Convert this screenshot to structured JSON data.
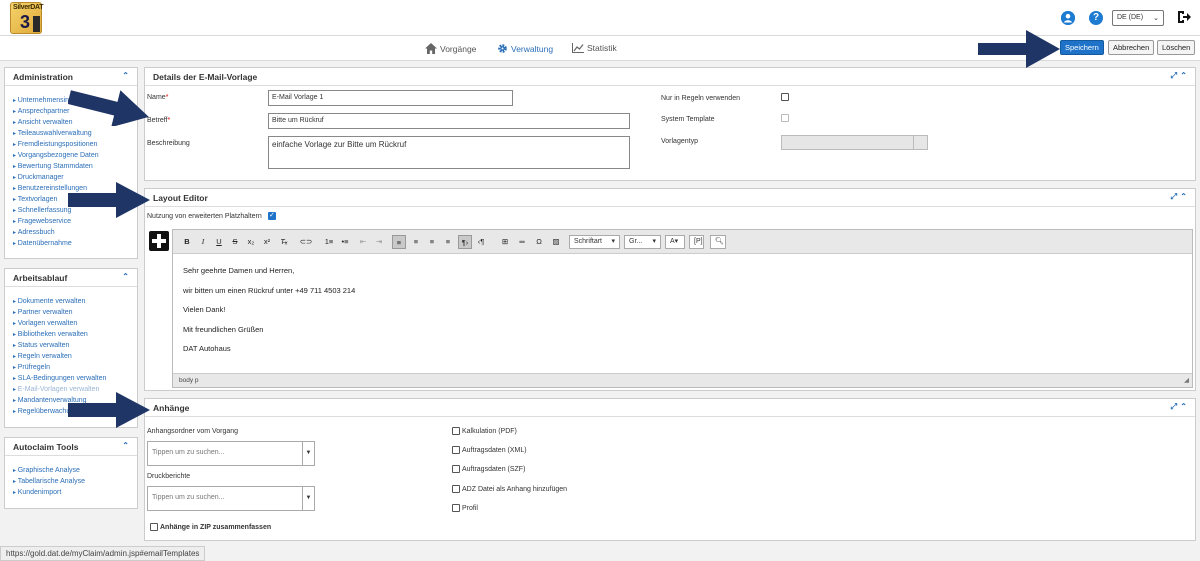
{
  "app": {
    "logo_text": "SilverDAT",
    "logo_number": "3",
    "language": "DE (DE)",
    "url": "https://gold.dat.de/myClaim/admin.jsp#emailTemplates"
  },
  "nav": {
    "items": [
      {
        "label": "Vorgänge",
        "icon": "home-icon"
      },
      {
        "label": "Verwaltung",
        "icon": "gear-icon"
      },
      {
        "label": "Statistik",
        "icon": "chart-icon"
      }
    ]
  },
  "actions": {
    "save": "Speichern",
    "cancel": "Abbrechen",
    "delete": "Löschen"
  },
  "sidebar": {
    "administration": {
      "title": "Administration",
      "items": [
        "Unternehmensinfo",
        "Ansprechpartner",
        "Ansicht verwalten",
        "Teileauswahlverwaltung",
        "Fremdleistungspositionen",
        "Vorgangsbezogene Daten",
        "Bewertung Stammdaten",
        "Druckmanager",
        "Benutzereinstellungen",
        "Textvorlagen",
        "Schnellerfassung",
        "Fragewebservice",
        "Adressbuch",
        "Datenübernahme"
      ]
    },
    "workflow": {
      "title": "Arbeitsablauf",
      "items": [
        "Dokumente verwalten",
        "Partner verwalten",
        "Vorlagen verwalten",
        "Bibliotheken verwalten",
        "Status verwalten",
        "Regeln verwalten",
        "Prüfregeln",
        "SLA-Bedingungen verwalten",
        "E-Mail-Vorlagen verwalten",
        "Mandantenverwaltung",
        "Regelüberwachung"
      ]
    },
    "autoclaim": {
      "title": "Autoclaim Tools",
      "items": [
        "Graphische Analyse",
        "Tabellarische Analyse",
        "Kundenimport"
      ]
    }
  },
  "details": {
    "title": "Details der E-Mail-Vorlage",
    "name_label": "Name",
    "name_value": "E-Mail Vorlage 1",
    "subject_label": "Betreff",
    "subject_value": "Bitte um Rückruf",
    "description_label": "Beschreibung",
    "description_value": "einfache Vorlage zur Bitte um Rückruf",
    "rules_only_label": "Nur in Regeln verwenden",
    "system_template_label": "System Template",
    "template_type_label": "Vorlagentyp",
    "required_mark": "*"
  },
  "layout_editor": {
    "title": "Layout Editor",
    "extended_placeholders_label": "Nutzung von erweiterten Platzhaltern",
    "font_dropdown": "Schriftart",
    "size_dropdown": "Gr...",
    "content": [
      "Sehr geehrte Damen und Herren,",
      "wir bitten um einen Rückruf unter +49 711 4503 214",
      "Vielen Dank!",
      "Mit freundlichen Grüßen",
      "DAT Autohaus"
    ],
    "status_path": "body   p"
  },
  "attachments": {
    "title": "Anhänge",
    "folder_label": "Anhangsordner vom Vorgang",
    "folder_placeholder": "Tippen um zu suchen...",
    "print_label": "Druckberichte",
    "print_placeholder": "Tippen um zu suchen...",
    "zip_label": "Anhänge in ZIP zusammenfassen",
    "options": [
      "Kalkulation (PDF)",
      "Auftragsdaten (XML)",
      "Auftragsdaten (SZF)",
      "ADZ Datei als Anhang hinzufügen",
      "Profil"
    ]
  },
  "colors": {
    "accent": "#1e73c9",
    "link": "#2a6eb8",
    "arrow": "#1f3566"
  }
}
